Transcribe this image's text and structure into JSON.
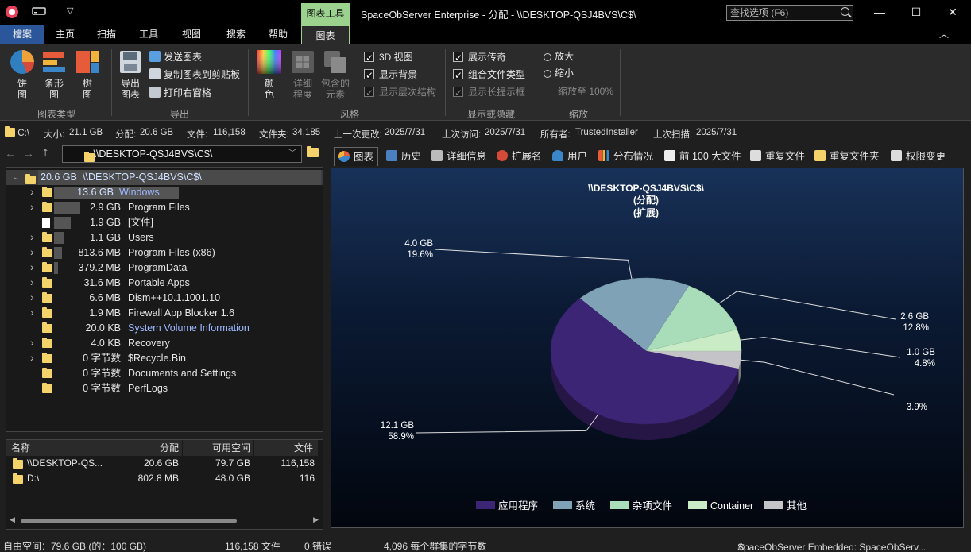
{
  "titlebar": {
    "context_tab": "图表工具",
    "title": "SpaceObServer Enterprise - 分配 - \\\\DESKTOP-QSJ4BVS\\C$\\",
    "search_placeholder": "查找选项 (F6)",
    "minimize": "—",
    "maximize": "☐",
    "close": "✕"
  },
  "ribbon_tabs": [
    "檔案",
    "主页",
    "扫描",
    "工具",
    "视图",
    "搜索",
    "帮助",
    "图表"
  ],
  "ribbon": {
    "chart_type": {
      "label": "图表类型",
      "pie": "饼\n图",
      "bar": "条形\n图",
      "tree": "树\n图"
    },
    "export": {
      "label": "导出",
      "export_chart": "导出\n图表",
      "send_chart": "发送图表",
      "copy_clipboard": "复制图表到剪贴板",
      "print_window": "打印右窗格"
    },
    "style": {
      "label": "风格",
      "color": "颜\n色",
      "detail": "详细\n程度",
      "contained": "包含的\n元素",
      "opt_3d": "3D 视图",
      "opt_background": "显示背景",
      "opt_hierarchy": "显示层次结构"
    },
    "show_hide": {
      "label": "显示或隐藏",
      "legend": "展示传奇",
      "combine": "组合文件类型",
      "tooltips": "显示长提示框"
    },
    "zoom": {
      "label": "缩放",
      "zoom_in": "放大",
      "zoom_out": "缩小",
      "zoom_100": "缩放至 100%"
    }
  },
  "infobar": {
    "drive": "C:\\",
    "size_label": "大小:",
    "size": "21.1 GB",
    "alloc_label": "分配:",
    "alloc": "20.6 GB",
    "files_label": "文件:",
    "files": "116,158",
    "folders_label": "文件夹:",
    "folders": "34,185",
    "last_change_label": "上一次更改:",
    "last_change": "2025/7/31",
    "last_access_label": "上次访问:",
    "last_access": "2025/7/31",
    "owner_label": "所有者:",
    "owner": "TrustedInstaller",
    "last_scan_label": "上次扫描:",
    "last_scan": "2025/7/31"
  },
  "nav": {
    "path": "\\\\DESKTOP-QSJ4BVS\\C$\\"
  },
  "tree": {
    "root": {
      "size": "20.6 GB",
      "name": "\\\\DESKTOP-QSJ4BVS\\C$\\"
    },
    "items": [
      {
        "size": "13.6 GB",
        "name": "Windows",
        "expand": true,
        "selected": true,
        "fill": 0.66,
        "type": "folder"
      },
      {
        "size": "2.9 GB",
        "name": "Program Files",
        "expand": true,
        "fill": 0.14,
        "type": "folder"
      },
      {
        "size": "1.9 GB",
        "name": "[文件]",
        "expand": false,
        "fill": 0.09,
        "type": "file"
      },
      {
        "size": "1.1 GB",
        "name": "Users",
        "expand": true,
        "fill": 0.05,
        "type": "folder"
      },
      {
        "size": "813.6 MB",
        "name": "Program Files (x86)",
        "expand": true,
        "fill": 0.04,
        "type": "folder"
      },
      {
        "size": "379.2 MB",
        "name": "ProgramData",
        "expand": true,
        "fill": 0.02,
        "type": "folder"
      },
      {
        "size": "31.6 MB",
        "name": "Portable Apps",
        "expand": true,
        "fill": 0,
        "type": "folder"
      },
      {
        "size": "6.6 MB",
        "name": "Dism++10.1.1001.10",
        "expand": true,
        "fill": 0,
        "type": "folder"
      },
      {
        "size": "1.9 MB",
        "name": "Firewall App Blocker 1.6",
        "expand": true,
        "fill": 0,
        "type": "folder"
      },
      {
        "size": "20.0 KB",
        "name": "System Volume Information",
        "expand": false,
        "fill": 0,
        "type": "folder",
        "highlight": true
      },
      {
        "size": "4.0 KB",
        "name": "Recovery",
        "expand": true,
        "fill": 0,
        "type": "folder"
      },
      {
        "size": "0 字节数",
        "name": "$Recycle.Bin",
        "expand": true,
        "fill": 0,
        "type": "folder"
      },
      {
        "size": "0 字节数",
        "name": "Documents and Settings",
        "expand": false,
        "fill": 0,
        "type": "link"
      },
      {
        "size": "0 字节数",
        "name": "PerfLogs",
        "expand": false,
        "fill": 0,
        "type": "folder"
      }
    ]
  },
  "list": {
    "columns": [
      "名称",
      "分配",
      "可用空间",
      "文件"
    ],
    "rows": [
      {
        "name": "\\\\DESKTOP-QS...",
        "alloc": "20.6 GB",
        "free": "79.7 GB",
        "files": "116,158"
      },
      {
        "name": "D:\\",
        "alloc": "802.8 MB",
        "free": "48.0 GB",
        "files": "116"
      }
    ]
  },
  "view_tabs": [
    "图表",
    "历史",
    "详细信息",
    "扩展名",
    "用户",
    "分布情况",
    "前 100 大文件",
    "重复文件",
    "重复文件夹",
    "权限变更"
  ],
  "chart_data": {
    "type": "pie",
    "title": "\\\\DESKTOP-QSJ4BVS\\C$\\",
    "subtitle_1": "(分配)",
    "subtitle_2": "(扩展)",
    "three_d": true,
    "legend_position": "bottom",
    "series": [
      {
        "name": "应用程序",
        "size": "12.1 GB",
        "pct": "58.9%",
        "value": 58.9,
        "color": "#3d2575"
      },
      {
        "name": "系统",
        "size": "4.0 GB",
        "pct": "19.6%",
        "value": 19.6,
        "color": "#7fa2b7"
      },
      {
        "name": "杂项文件",
        "size": "2.6 GB",
        "pct": "12.8%",
        "value": 12.8,
        "color": "#a9dcb8"
      },
      {
        "name": "Container",
        "size": "1.0 GB",
        "pct": "4.8%",
        "value": 4.8,
        "color": "#c9ecc6"
      },
      {
        "name": "其他",
        "size": "",
        "pct": "3.9%",
        "value": 3.9,
        "color": "#c4c4c8"
      }
    ]
  },
  "statusbar": {
    "free_space": "自由空间：79.6 GB (的：100 GB)",
    "files": "116,158 文件",
    "errors": "0 错误",
    "cluster": "4,096 每个群集的字节数",
    "embedded": "SpaceObServer Embedded: SpaceObServ..."
  }
}
